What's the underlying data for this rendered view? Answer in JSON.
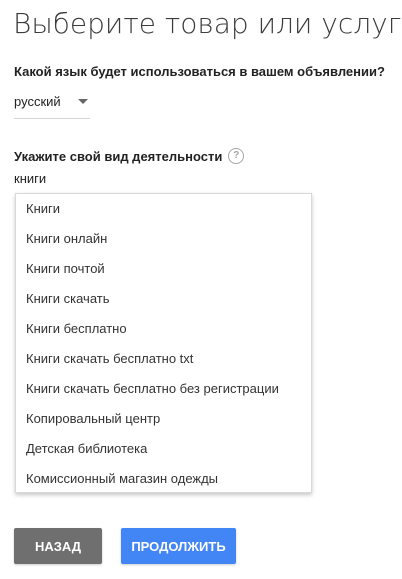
{
  "page": {
    "title": "Выберите товар или услугу"
  },
  "language": {
    "label": "Какой язык будет использоваться в вашем объявлении?",
    "selected": "русский"
  },
  "activity": {
    "label": "Укажите свой вид деятельности",
    "help_icon": "question-circle-icon",
    "help_glyph": "?",
    "value": "книги",
    "suggestions": [
      "Книги",
      "Книги онлайн",
      "Книги почтой",
      "Книги скачать",
      "Книги бесплатно",
      "Книги скачать бесплатно txt",
      "Книги скачать бесплатно без регистрации",
      "Копировальный центр",
      "Детская библиотека",
      "Комиссионный магазин одежды"
    ]
  },
  "actions": {
    "back_label": "НАЗАД",
    "continue_label": "ПРОДОЛЖИТЬ"
  },
  "colors": {
    "back_button": "#6f6f6f",
    "continue_button": "#4285f4"
  }
}
